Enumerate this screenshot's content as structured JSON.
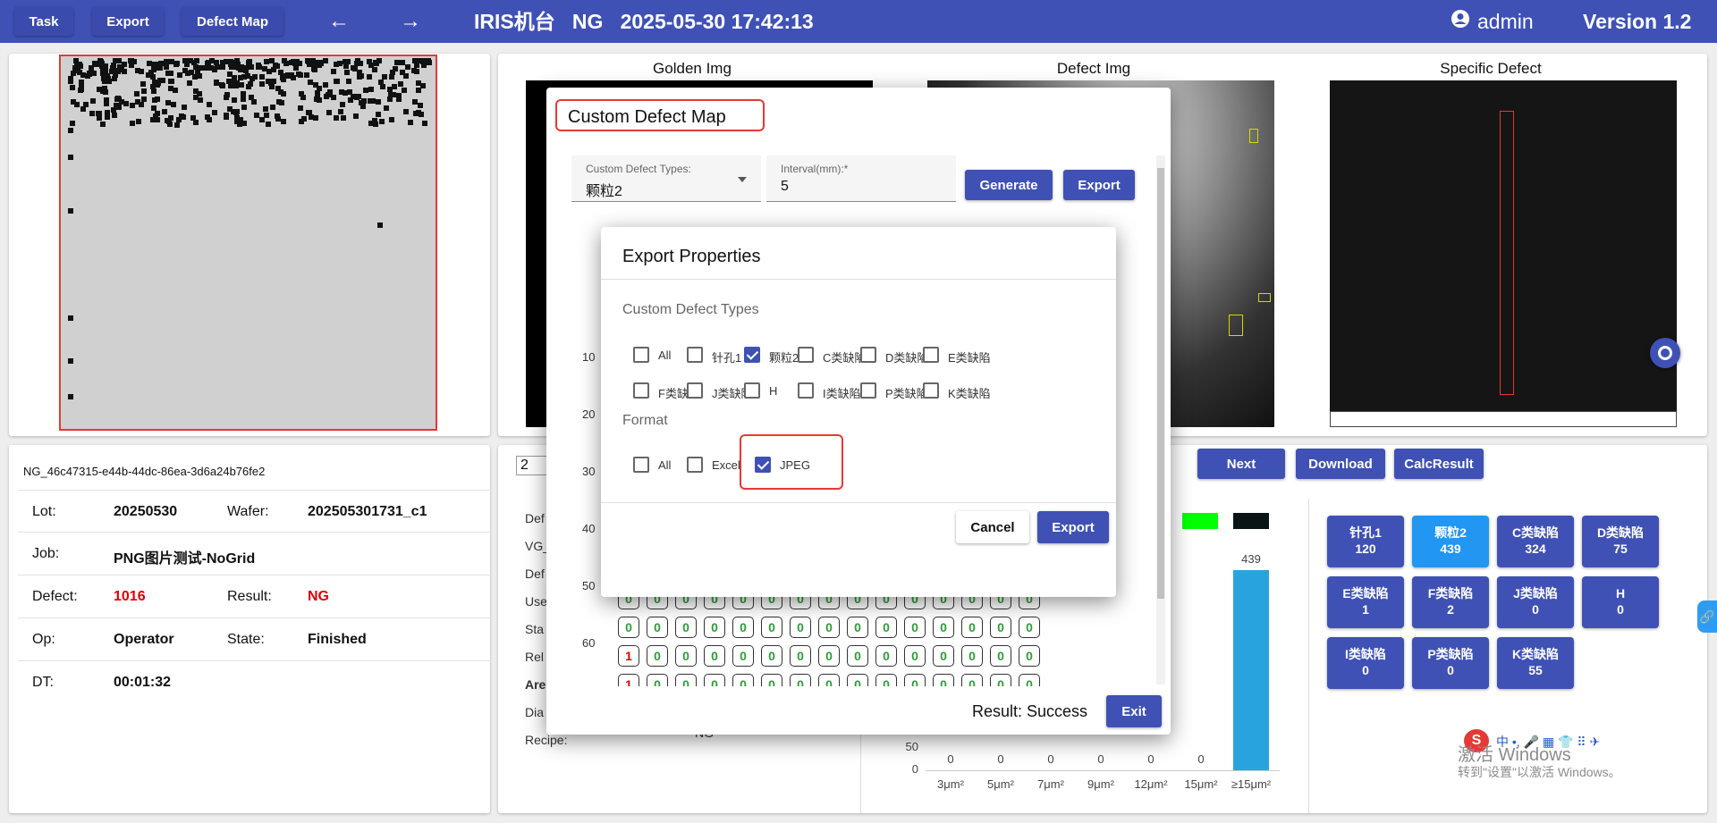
{
  "topbar": {
    "task_label": "Task",
    "export_label": "Export",
    "defect_map_label": "Defect Map",
    "machine": "IRIS机台",
    "status": "NG",
    "datetime": "2025-05-30 17:42:13",
    "user": "admin",
    "version": "Version 1.2"
  },
  "images": {
    "golden_label": "Golden Img",
    "defect_label": "Defect Img",
    "specific_label": "Specific Defect"
  },
  "info": {
    "id": "NG_46c47315-e44b-44dc-86ea-3d6a24b76fe2",
    "lot_label": "Lot:",
    "lot": "20250530",
    "wafer_label": "Wafer:",
    "wafer": "202505301731_c1",
    "job_label": "Job:",
    "job": "PNG图片测试-NoGrid",
    "defect_label": "Defect:",
    "defect": "1016",
    "result_label": "Result:",
    "result": "NG",
    "op_label": "Op:",
    "op": "Operator",
    "state_label": "State:",
    "state": "Finished",
    "dt_label": "DT:",
    "dt": "00:01:32"
  },
  "controls": {
    "page_input": "2",
    "partial_btn": "s",
    "next": "Next",
    "download": "Download",
    "calc": "CalcResult"
  },
  "side_labels": [
    "Def",
    "VG_",
    "Def",
    "Use",
    "Sta",
    "Rel",
    "Are",
    "Dia",
    "Recipe:"
  ],
  "side_value": "NG",
  "tiles": [
    {
      "name": "针孔1",
      "count": "120"
    },
    {
      "name": "颗粒2",
      "count": "439"
    },
    {
      "name": "C类缺陷",
      "count": "324"
    },
    {
      "name": "D类缺陷",
      "count": "75"
    },
    {
      "name": "E类缺陷",
      "count": "1"
    },
    {
      "name": "F类缺陷",
      "count": "2"
    },
    {
      "name": "J类缺陷",
      "count": "0"
    },
    {
      "name": "H",
      "count": "0"
    },
    {
      "name": "I类缺陷",
      "count": "0"
    },
    {
      "name": "P类缺陷",
      "count": "0"
    },
    {
      "name": "K类缺陷",
      "count": "55"
    }
  ],
  "chart_data": {
    "type": "bar",
    "categories": [
      "3μm²",
      "5μm²",
      "7μm²",
      "9μm²",
      "12μm²",
      "15μm²",
      "≥15μm²"
    ],
    "values": [
      0,
      0,
      0,
      0,
      0,
      0,
      439
    ],
    "y_ticks_visible": [
      "0",
      "50"
    ],
    "data_labels": [
      "0",
      "0",
      "0",
      "0",
      "0",
      "0",
      "439"
    ],
    "bar_color": "#29a3dc"
  },
  "grid": {
    "y_labels": [
      "10",
      "20",
      "30",
      "40",
      "50",
      "60"
    ],
    "rows": [
      [
        "0",
        "0",
        "0",
        "0",
        "0",
        "0",
        "0",
        "0",
        "0",
        "0",
        "0",
        "0",
        "0",
        "0",
        "0"
      ],
      [
        "0",
        "0",
        "0",
        "0",
        "0",
        "0",
        "0",
        "0",
        "0",
        "0",
        "0",
        "0",
        "0",
        "0",
        "0"
      ],
      [
        "1",
        "0",
        "0",
        "0",
        "0",
        "0",
        "0",
        "0",
        "0",
        "0",
        "0",
        "0",
        "0",
        "0",
        "0"
      ],
      [
        "1",
        "0",
        "0",
        "0",
        "0",
        "0",
        "0",
        "0",
        "0",
        "0",
        "0",
        "0",
        "0",
        "0",
        "0"
      ]
    ]
  },
  "custom_dialog": {
    "title": "Custom Defect Map",
    "types_label": "Custom Defect Types:",
    "types_value": "颗粒2",
    "interval_label": "Interval(mm):*",
    "interval_value": "5",
    "generate": "Generate",
    "export": "Export",
    "result": "Result: Success",
    "exit": "Exit"
  },
  "export_dialog": {
    "title": "Export Properties",
    "types_heading": "Custom Defect Types",
    "types": [
      {
        "label": "All",
        "checked": false
      },
      {
        "label": "针孔1",
        "checked": false
      },
      {
        "label": "颗粒2",
        "checked": true
      },
      {
        "label": "C类缺陷",
        "checked": false
      },
      {
        "label": "D类缺陷",
        "checked": false
      },
      {
        "label": "E类缺陷",
        "checked": false
      },
      {
        "label": "F类缺陷",
        "checked": false
      },
      {
        "label": "J类缺陷",
        "checked": false
      },
      {
        "label": "H",
        "checked": false
      },
      {
        "label": "I类缺陷",
        "checked": false
      },
      {
        "label": "P类缺陷",
        "checked": false
      },
      {
        "label": "K类缺陷",
        "checked": false
      }
    ],
    "format_heading": "Format",
    "formats": [
      {
        "label": "All",
        "checked": false
      },
      {
        "label": "Excel",
        "checked": false
      },
      {
        "label": "JPEG",
        "checked": true
      }
    ],
    "cancel": "Cancel",
    "export": "Export"
  },
  "watermark": {
    "line1": "激活 Windows",
    "line2": "转到\"设置\"以激活 Windows。"
  },
  "colors": {
    "primary": "#3f51b5",
    "active_tile": "#2196f3",
    "highlight": "#e53935",
    "legend_green": "#00ff00"
  }
}
